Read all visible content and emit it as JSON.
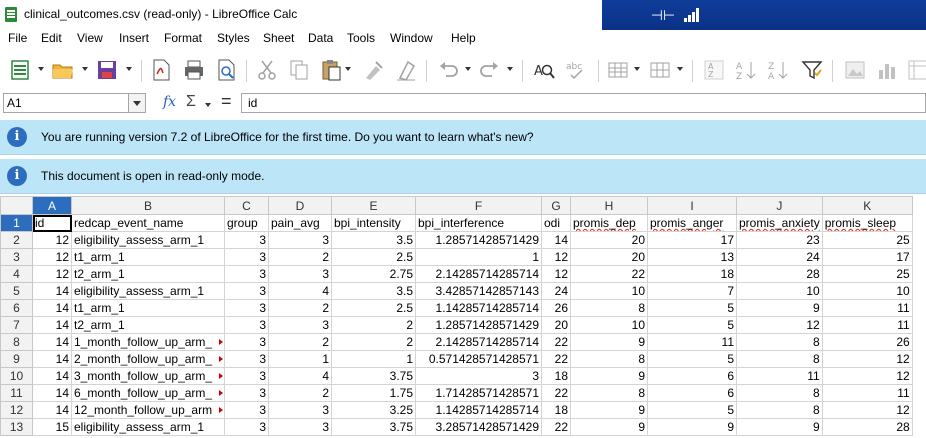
{
  "window": {
    "title": "clinical_outcomes.csv (read-only) - LibreOffice Calc"
  },
  "menu": [
    "File",
    "Edit",
    "View",
    "Insert",
    "Format",
    "Styles",
    "Sheet",
    "Data",
    "Tools",
    "Window",
    "Help"
  ],
  "formula_bar": {
    "cell_ref": "A1",
    "formula": "id"
  },
  "infobars": [
    {
      "message": "You are running version 7.2 of LibreOffice for the first time. Do you want to learn what's new?"
    },
    {
      "message": "This document is open in read-only mode."
    }
  ],
  "sheet": {
    "columns": [
      "A",
      "B",
      "C",
      "D",
      "E",
      "F",
      "G",
      "H",
      "I",
      "J",
      "K"
    ],
    "selected_column": "A",
    "selected_row": "1",
    "rows": [
      {
        "n": "1",
        "cells": [
          "id",
          "redcap_event_name",
          "group",
          "pain_avg",
          "bpi_intensity",
          "bpi_interference",
          "odi",
          "promis_dep",
          "promis_anger",
          "promis_anxiety",
          "promis_sleep"
        ]
      },
      {
        "n": "2",
        "cells": [
          "12",
          "eligibility_assess_arm_1",
          "3",
          "3",
          "3.5",
          "1.28571428571429",
          "14",
          "20",
          "17",
          "23",
          "25"
        ]
      },
      {
        "n": "3",
        "cells": [
          "12",
          "t1_arm_1",
          "3",
          "2",
          "2.5",
          "1",
          "12",
          "20",
          "13",
          "24",
          "17"
        ]
      },
      {
        "n": "4",
        "cells": [
          "12",
          "t2_arm_1",
          "3",
          "3",
          "2.75",
          "2.14285714285714",
          "12",
          "22",
          "18",
          "28",
          "25"
        ]
      },
      {
        "n": "5",
        "cells": [
          "14",
          "eligibility_assess_arm_1",
          "3",
          "4",
          "3.5",
          "3.42857142857143",
          "24",
          "10",
          "7",
          "10",
          "10"
        ]
      },
      {
        "n": "6",
        "cells": [
          "14",
          "t1_arm_1",
          "3",
          "2",
          "2.5",
          "1.14285714285714",
          "26",
          "8",
          "5",
          "9",
          "11"
        ]
      },
      {
        "n": "7",
        "cells": [
          "14",
          "t2_arm_1",
          "3",
          "3",
          "2",
          "1.28571428571429",
          "20",
          "10",
          "5",
          "12",
          "11"
        ]
      },
      {
        "n": "8",
        "cells": [
          "14",
          "1_month_follow_up_arm_",
          "3",
          "2",
          "2",
          "2.14285714285714",
          "22",
          "9",
          "11",
          "8",
          "26"
        ]
      },
      {
        "n": "9",
        "cells": [
          "14",
          "2_month_follow_up_arm_",
          "3",
          "1",
          "1",
          "0.571428571428571",
          "22",
          "8",
          "5",
          "8",
          "12"
        ]
      },
      {
        "n": "10",
        "cells": [
          "14",
          "3_month_follow_up_arm_",
          "3",
          "4",
          "3.75",
          "3",
          "18",
          "9",
          "6",
          "11",
          "12"
        ]
      },
      {
        "n": "11",
        "cells": [
          "14",
          "6_month_follow_up_arm_",
          "3",
          "2",
          "1.75",
          "1.71428571428571",
          "22",
          "8",
          "6",
          "8",
          "11"
        ]
      },
      {
        "n": "12",
        "cells": [
          "14",
          "12_month_follow_up_arm",
          "3",
          "3",
          "3.25",
          "1.14285714285714",
          "18",
          "9",
          "5",
          "8",
          "12"
        ]
      },
      {
        "n": "13",
        "cells": [
          "15",
          "eligibility_assess_arm_1",
          "3",
          "3",
          "3.75",
          "3.28571428571429",
          "22",
          "9",
          "9",
          "9",
          "28"
        ]
      }
    ]
  }
}
